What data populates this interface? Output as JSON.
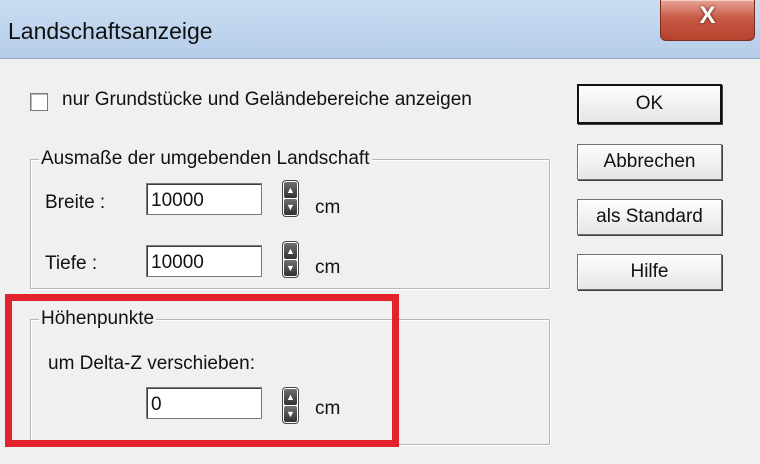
{
  "window": {
    "title": "Landschaftsanzeige",
    "close_label": "X"
  },
  "checkbox": {
    "label": "nur Grundstücke und Geländebereiche anzeigen",
    "checked": false
  },
  "landscape_group": {
    "title": "Ausmaße der umgebenden Landschaft",
    "width_label": "Breite :",
    "width_value": "10000",
    "width_unit": "cm",
    "depth_label": "Tiefe :",
    "depth_value": "10000",
    "depth_unit": "cm"
  },
  "heights_group": {
    "title": "Höhenpunkte",
    "shift_label": "um Delta-Z verschieben:",
    "shift_value": "0",
    "shift_unit": "cm"
  },
  "buttons": {
    "ok": "OK",
    "cancel": "Abbrechen",
    "default": "als Standard",
    "help": "Hilfe"
  },
  "colors": {
    "highlight": "#e3232b",
    "titlebar": "#c2d6ef",
    "close": "#c75a47"
  }
}
